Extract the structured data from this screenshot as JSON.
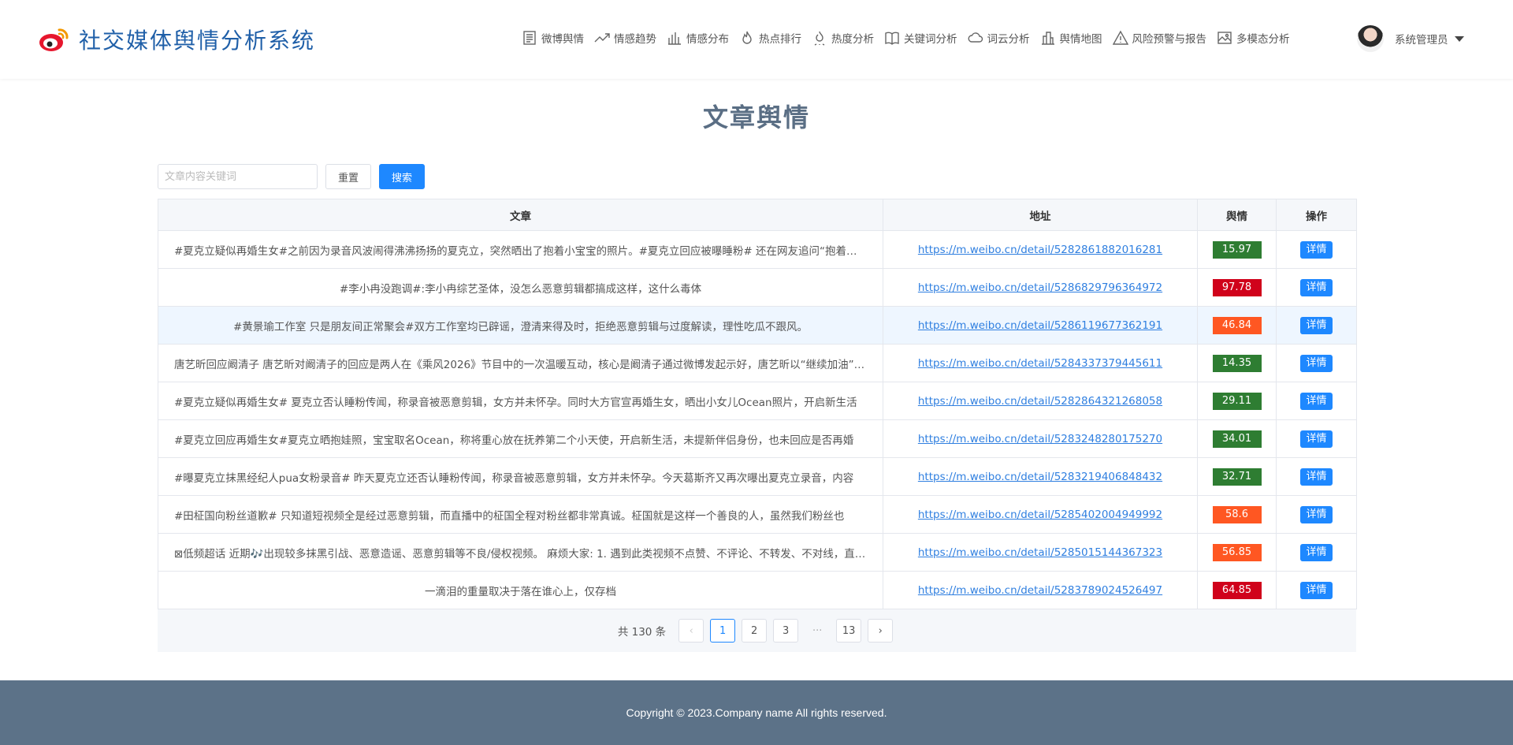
{
  "header": {
    "app_title": "社交媒体舆情分析系统",
    "nav": [
      {
        "label": "微博舆情",
        "icon": "document-icon"
      },
      {
        "label": "情感趋势",
        "icon": "trend-icon"
      },
      {
        "label": "情感分布",
        "icon": "bar-chart-icon"
      },
      {
        "label": "热点排行",
        "icon": "flame-icon"
      },
      {
        "label": "热度分析",
        "icon": "fire-analysis-icon"
      },
      {
        "label": "关键词分析",
        "icon": "book-icon"
      },
      {
        "label": "词云分析",
        "icon": "cloud-icon"
      },
      {
        "label": "舆情地图",
        "icon": "building-icon"
      },
      {
        "label": "风险预警与报告",
        "icon": "warning-icon"
      },
      {
        "label": "多模态分析",
        "icon": "image-icon"
      }
    ],
    "user_name": "系统管理员"
  },
  "page": {
    "title": "文章舆情"
  },
  "search": {
    "placeholder": "文章内容关键词",
    "value": "",
    "reset_label": "重置",
    "search_label": "搜索"
  },
  "table": {
    "columns": [
      "文章",
      "地址",
      "舆情",
      "操作"
    ],
    "rows": [
      {
        "article": "#夏克立疑似再婚生女#之前因为录音风波闹得沸沸扬扬的夏克立，突然晒出了抱着小宝宝的照片。#夏克立回应被曝睡粉# 还在网友追问“抱着的是谁”",
        "align": "left",
        "url": "https://m.weibo.cn/detail/5282861882016281",
        "score": "15.97",
        "score_color": "#2e7d32",
        "action": "详情"
      },
      {
        "article": "#李小冉没跑调#:李小冉综艺圣体，没怎么恶意剪辑都搞成这样，这什么毒体",
        "align": "center",
        "url": "https://m.weibo.cn/detail/5286829796364972",
        "score": "97.78",
        "score_color": "#d0021b",
        "action": "详情"
      },
      {
        "article": "#黄景瑜工作室 只是朋友间正常聚会#双方工作室均已辟谣，澄清来得及时，拒绝恶意剪辑与过度解读，理性吃瓜不跟风。",
        "align": "center",
        "url": "https://m.weibo.cn/detail/5286119677362191",
        "score": "46.84",
        "score_color": "#ff5722",
        "action": "详情"
      },
      {
        "article": "唐艺昕回应阚清子 唐艺昕对阚清子的回应是两人在《乘风2026》节目中的一次温暖互动，核心是阚清子通过微博发起示好，唐艺昕以“继续加油”回应",
        "align": "left",
        "url": "https://m.weibo.cn/detail/5284337379445611",
        "score": "14.35",
        "score_color": "#2e7d32",
        "action": "详情"
      },
      {
        "article": "#夏克立疑似再婚生女# 夏克立否认睡粉传闻，称录音被恶意剪辑，女方并未怀孕。同时大方官宣再婚生女，晒出小女儿Ocean照片，开启新生活",
        "align": "left",
        "url": "https://m.weibo.cn/detail/5282864321268058",
        "score": "29.11",
        "score_color": "#2e7d32",
        "action": "详情"
      },
      {
        "article": "#夏克立回应再婚生女#夏克立晒抱娃照，宝宝取名Ocean，称将重心放在抚养第二个小天使，开启新生活，未提新伴侣身份，也未回应是否再婚",
        "align": "left",
        "url": "https://m.weibo.cn/detail/5283248280175270",
        "score": "34.01",
        "score_color": "#2e7d32",
        "action": "详情"
      },
      {
        "article": "#曝夏克立抹黑经纪人pua女粉录音# 昨天夏克立还否认睡粉传闻，称录音被恶意剪辑，女方并未怀孕。今天葛斯齐又再次曝出夏克立录音，内容",
        "align": "left",
        "url": "https://m.weibo.cn/detail/5283219406848432",
        "score": "32.71",
        "score_color": "#2e7d32",
        "action": "详情"
      },
      {
        "article": "#田柾国向粉丝道歉# 只知道短视频全是经过恶意剪辑，而直播中的柾国全程对粉丝都非常真诚。柾国就是这样一个善良的人，虽然我们粉丝也",
        "align": "left",
        "url": "https://m.weibo.cn/detail/5285402004949992",
        "score": "58.6",
        "score_color": "#ff5722",
        "action": "详情"
      },
      {
        "article": "⊠低频超话 近期🎶出现较多抹黑引战、恶意造谣、恶意剪辑等不良/侵权视频。 麻烦大家: 1. 遇到此类视频不点赞、不评论、不转发、不对线，直接举报",
        "align": "left",
        "url": "https://m.weibo.cn/detail/5285015144367323",
        "score": "56.85",
        "score_color": "#ff5722",
        "action": "详情"
      },
      {
        "article": "一滴泪的重量取决于落在谁心上，仅存档",
        "align": "center",
        "url": "https://m.weibo.cn/detail/5283789024526497",
        "score": "64.85",
        "score_color": "#d0021b",
        "action": "详情"
      }
    ]
  },
  "pagination": {
    "total_label": "共 130 条",
    "prev": "‹",
    "next": "›",
    "pages": [
      "1",
      "2",
      "3"
    ],
    "ellipsis": "···",
    "last_page": "13",
    "current": "1"
  },
  "footer": {
    "text": "Copyright © 2023.Company name All rights reserved."
  }
}
